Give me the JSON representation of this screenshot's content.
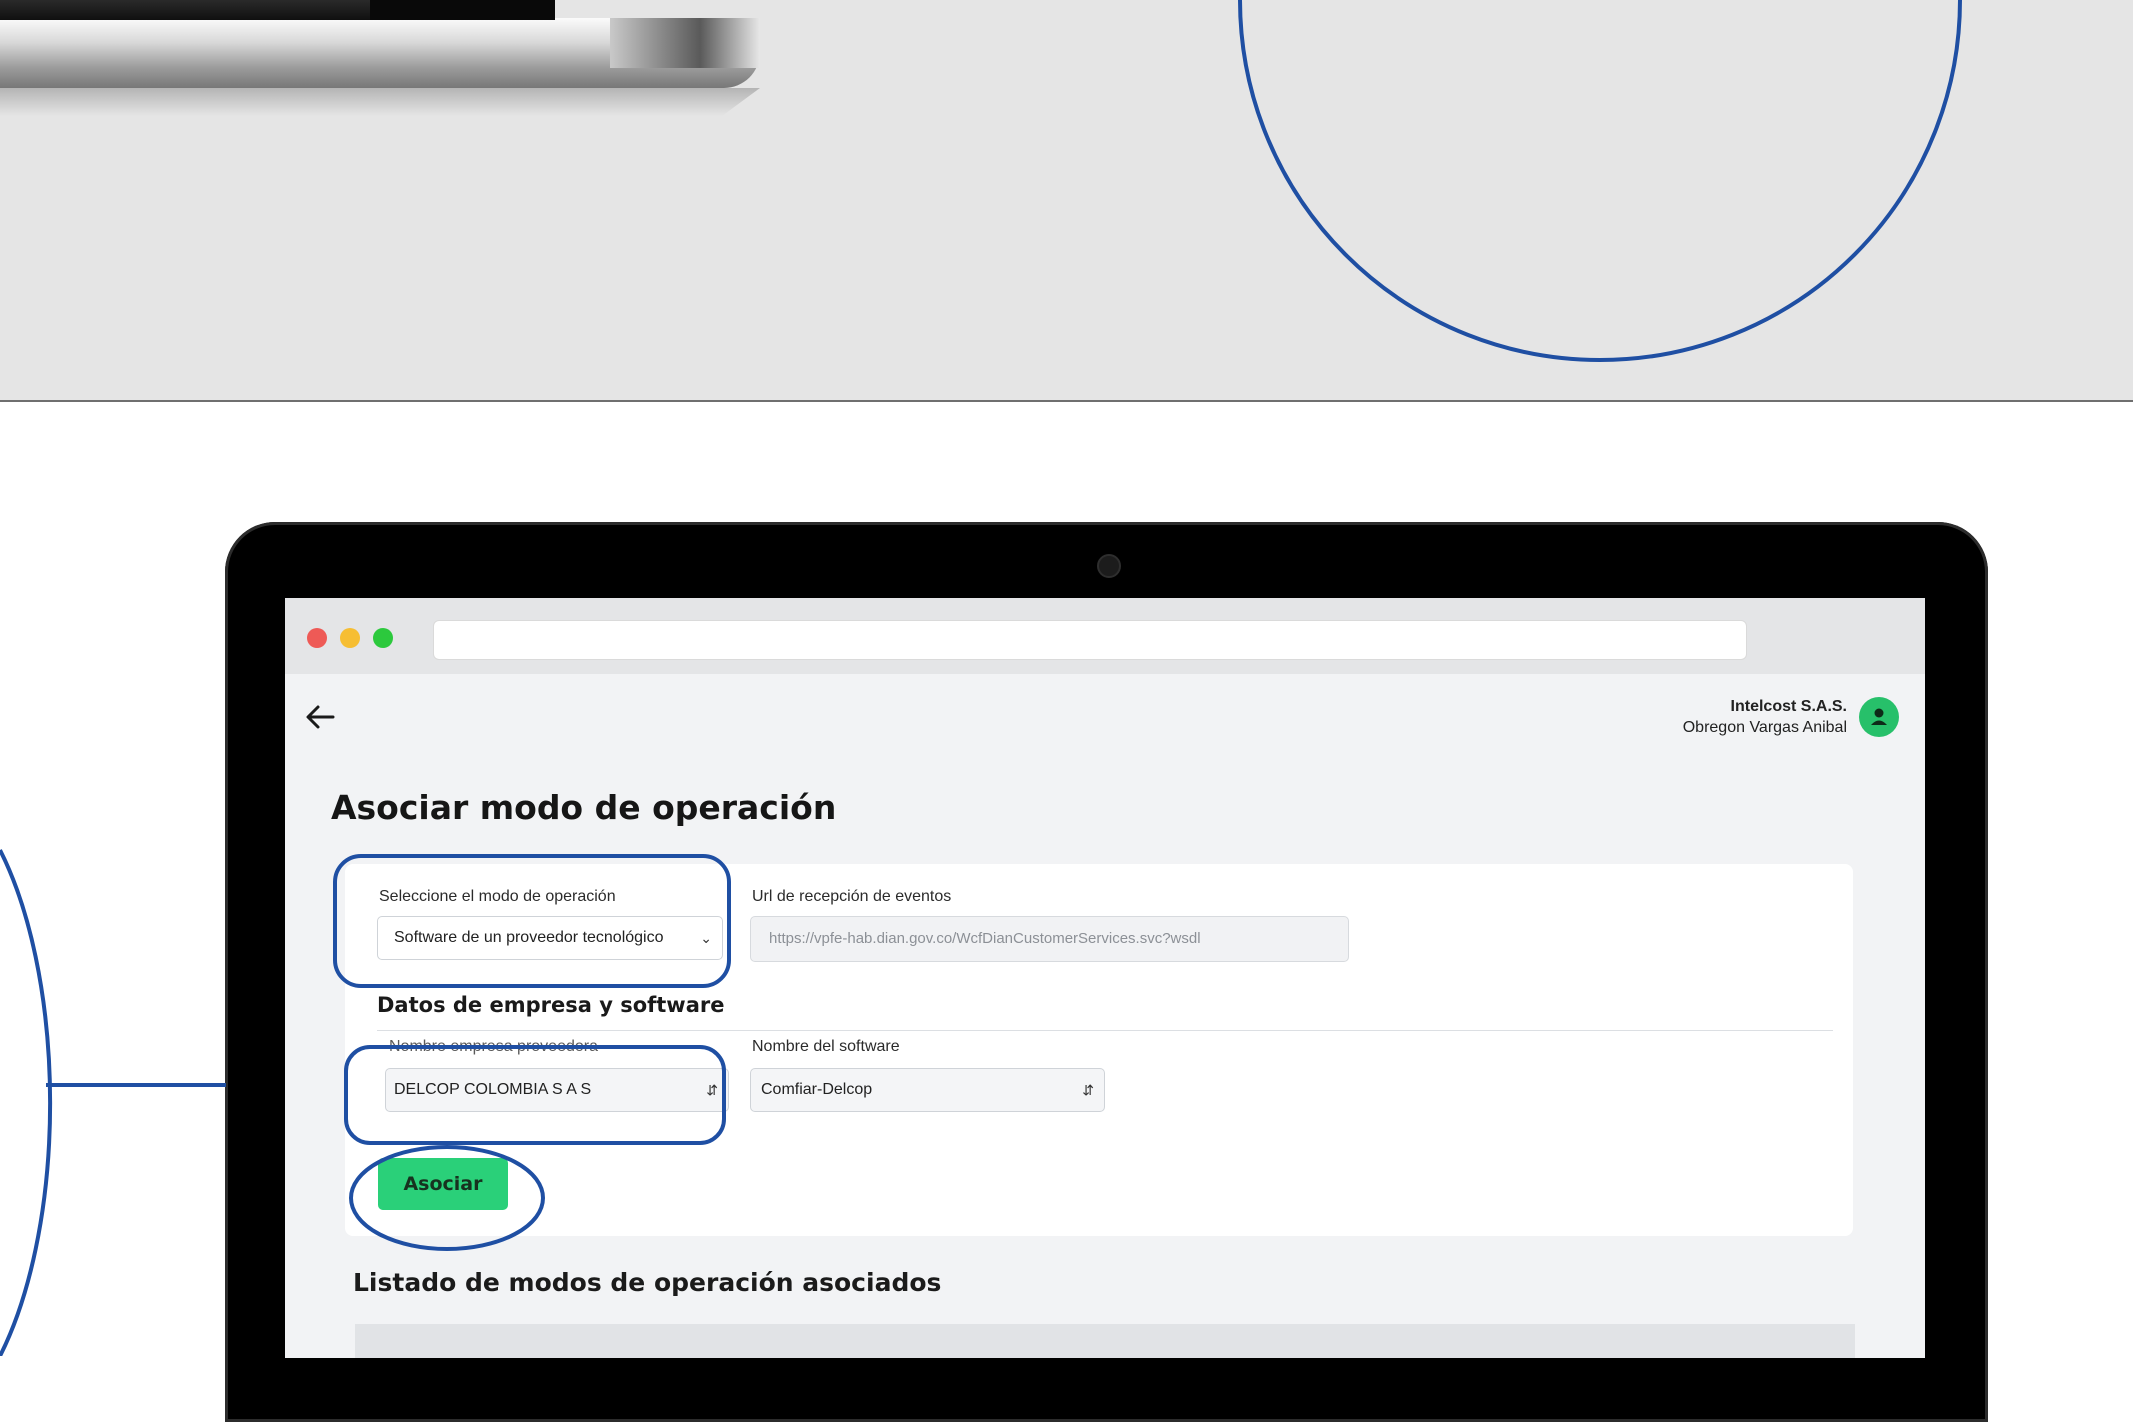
{
  "browser": {
    "url": ""
  },
  "header": {
    "company_name": "Intelcost S.A.S.",
    "user_name": "Obregon Vargas Anibal"
  },
  "page": {
    "title": "Asociar modo de operación"
  },
  "form": {
    "mode_label": "Seleccione el modo de operación",
    "mode_value": "Software de un proveedor tecnológico",
    "url_label": "Url de recepción de eventos",
    "url_value": "https://vpfe-hab.dian.gov.co/WcfDianCustomerServices.svc?wsdl",
    "section_title": "Datos de empresa y software",
    "provider_label": "Nombre empresa proveedora",
    "provider_value": "DELCOP COLOMBIA S A S",
    "software_label": "Nombre del software",
    "software_value": "Comfiar-Delcop",
    "submit_label": "Asociar"
  },
  "list": {
    "title": "Listado de modos de operación asociados"
  },
  "colors": {
    "highlight": "#1f4fa3",
    "accent_green": "#2ad079",
    "avatar_green": "#27c06a"
  }
}
